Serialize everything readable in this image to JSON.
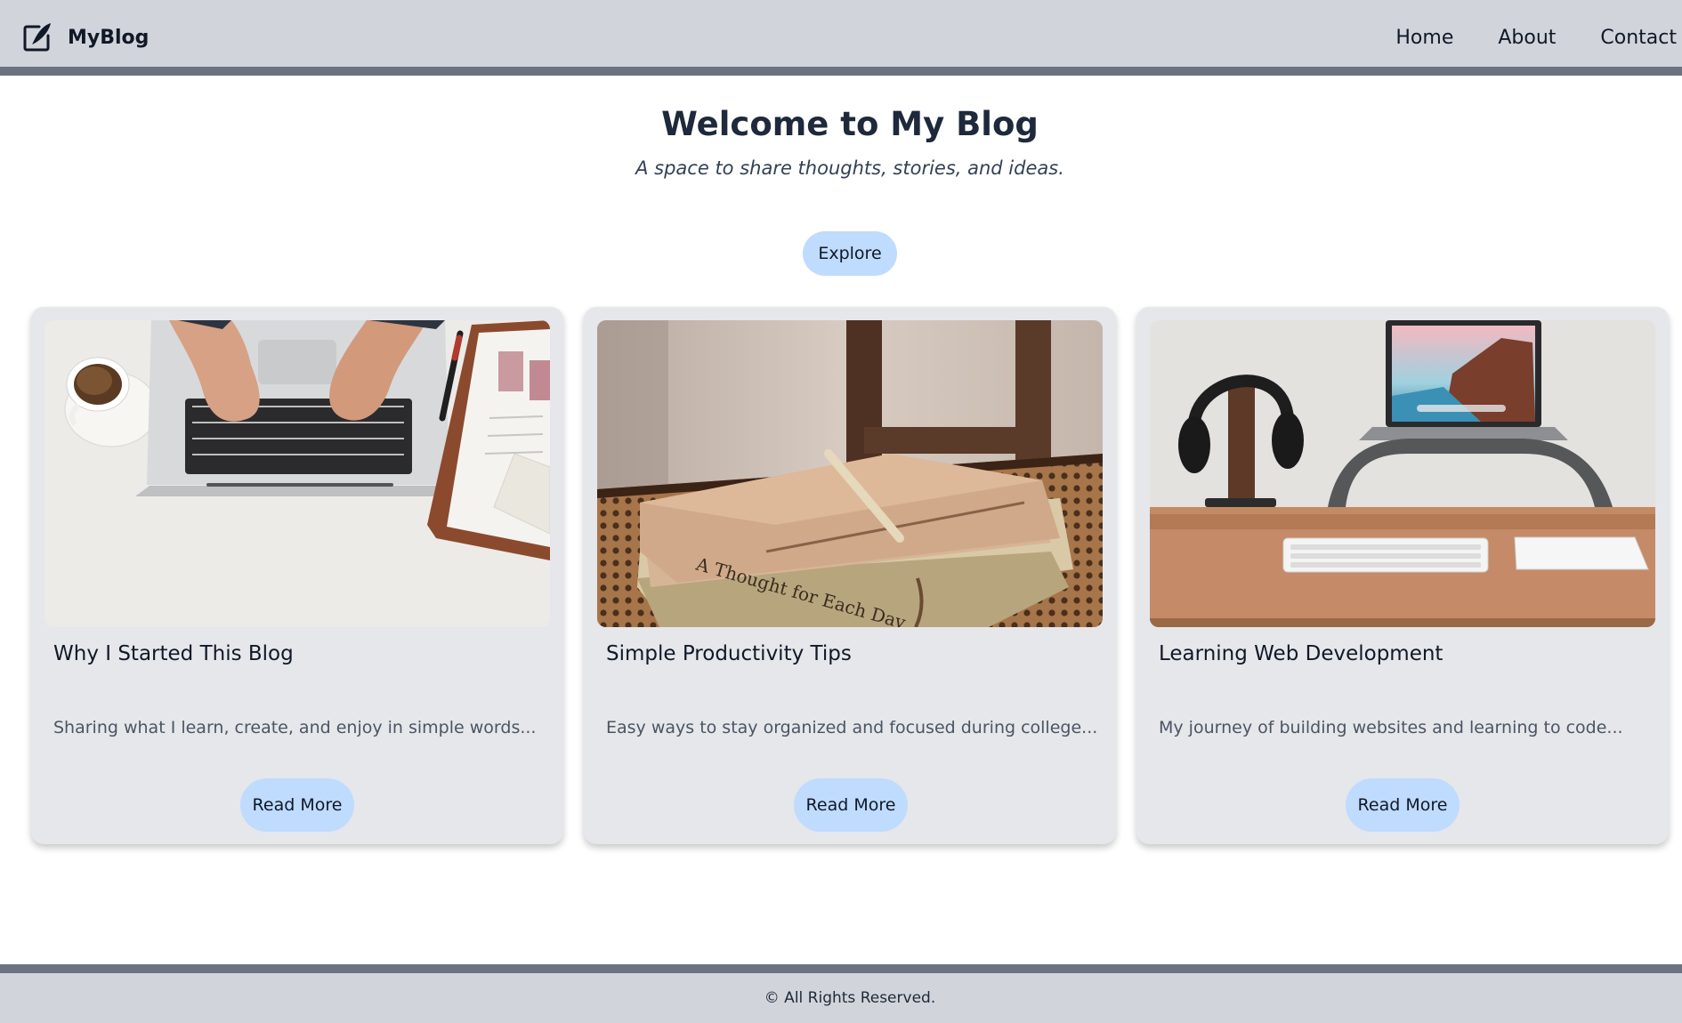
{
  "header": {
    "brand_name": "MyBlog",
    "brand_icon": "edit-pen-icon",
    "nav": [
      "Home",
      "About",
      "Contact"
    ]
  },
  "hero": {
    "title": "Welcome to My Blog",
    "subtitle": "A space to share thoughts, stories, and ideas.",
    "explore_label": "Explore"
  },
  "posts": [
    {
      "title": "Why I Started This Blog",
      "description": "Sharing what I learn, create, and enjoy in simple words...",
      "button_label": "Read More",
      "image": "laptop-typing-with-coffee-photo"
    },
    {
      "title": "Simple Productivity Tips",
      "description": "Easy ways to stay organized and focused during college...",
      "button_label": "Read More",
      "image": "notebook-and-book-on-chair-photo",
      "book_title": "A Thought for Each Day"
    },
    {
      "title": "Learning Web Development",
      "description": "My journey of building websites and learning to code...",
      "button_label": "Read More",
      "image": "desk-laptop-headphones-keyboard-photo"
    }
  ],
  "footer": {
    "text": "© All Rights Reserved."
  },
  "colors": {
    "header_bg": "#d1d5db",
    "header_border": "#6b7280",
    "button_bg": "#bfdbfe",
    "card_bg": "#e5e7eb"
  }
}
